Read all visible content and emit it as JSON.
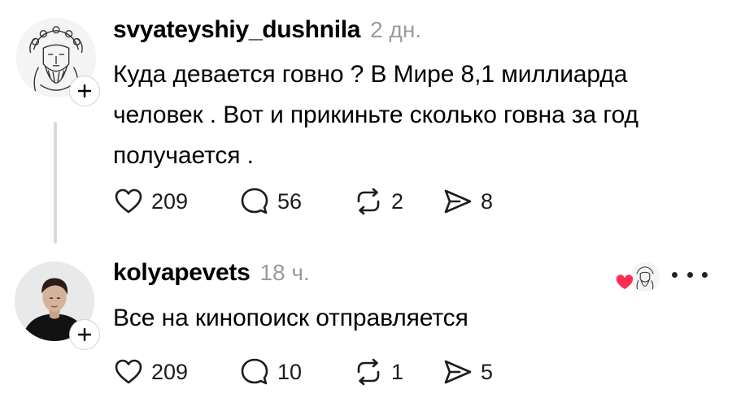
{
  "posts": [
    {
      "username": "svyateyshiy_dushnila",
      "timestamp": "2 дн.",
      "text": "Куда девается говно ? В Мире 8,1 миллиарда человек . Вот и прикиньте сколько говна за год получается .",
      "likes": "209",
      "comments": "56",
      "reposts": "2",
      "shares": "8"
    },
    {
      "username": "kolyapevets",
      "timestamp": "18 ч.",
      "text": "Все на кинопоиск отправляется",
      "likes": "209",
      "comments": "10",
      "reposts": "1",
      "shares": "5"
    }
  ],
  "icons": {
    "like": "heart-outline-icon",
    "comment": "speech-bubble-icon",
    "repost": "repost-arrows-icon",
    "share": "paper-plane-icon",
    "follow": "plus-icon",
    "more": "ellipsis-icon",
    "liked_by_author": "red-heart-icon"
  },
  "colors": {
    "text": "#000000",
    "timestamp": "#9b9b9b",
    "thread_line": "#d9d9d9",
    "heart_red": "#ff2d55"
  }
}
